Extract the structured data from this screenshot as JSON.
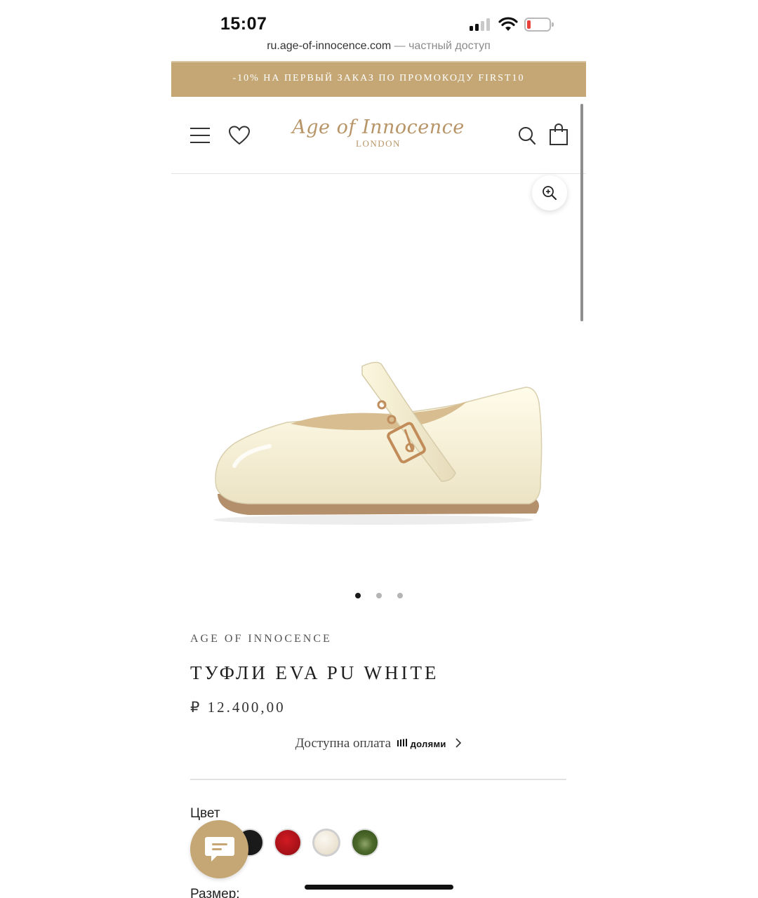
{
  "status_bar": {
    "time": "15:07"
  },
  "browser": {
    "url": "ru.age-of-innocence.com",
    "url_note": "— частный доступ"
  },
  "promo": {
    "text": "-10% НА ПЕРВЫЙ ЗАКАЗ ПО ПРОМОКОДУ FIRST10"
  },
  "header": {
    "logo_script": "Age of Innocence",
    "logo_sub": "LONDON",
    "icons": [
      "menu-icon",
      "heart-icon",
      "search-icon",
      "bag-icon"
    ]
  },
  "gallery": {
    "image_count": 3,
    "active_index": 0,
    "zoom_icon": "zoom-in-icon"
  },
  "product": {
    "brand": "AGE OF INNOCENCE",
    "title": "ТУФЛИ EVA PU WHITE",
    "price": "₽ 12.400,00",
    "installment_text": "Доступна оплата",
    "installment_provider": "долями"
  },
  "options": {
    "color_label": "Цвет",
    "colors": [
      "#1a1a1a",
      "#b3121a",
      "#efe6d7",
      "#4e6b2c"
    ],
    "selected_color_index": 2,
    "size_label": "Размер:"
  },
  "colors": {
    "accent": "#c4a774",
    "logo": "#b89568"
  }
}
